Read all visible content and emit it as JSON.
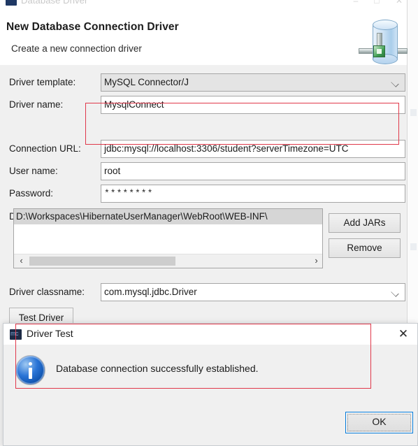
{
  "window": {
    "title": "Database Driver",
    "minimize_label": "–",
    "maximize_label": "□",
    "close_label": "✕"
  },
  "header": {
    "title": "New Database Connection Driver",
    "subtitle": "Create a new connection driver",
    "icon": "database-cylinder-icon"
  },
  "form": {
    "driver_template": {
      "label": "Driver template:",
      "value": "MySQL Connector/J",
      "caret": "chevron-down-icon"
    },
    "driver_name": {
      "label": "Driver name:",
      "value": "MysqlConnect"
    },
    "connection_url": {
      "label": "Connection URL:",
      "value": "jdbc:mysql://localhost:3306/student?serverTimezone=UTC"
    },
    "user_name": {
      "label": "User name:",
      "value": "root"
    },
    "password": {
      "label": "Password:",
      "value": "********"
    },
    "driver_jars": {
      "label": "Driver JARs",
      "items": [
        "D:\\Workspaces\\HibernateUserManager\\WebRoot\\WEB-INF\\"
      ],
      "add_button": "Add JARs",
      "remove_button": "Remove",
      "scroll_left": "‹",
      "scroll_right": "›"
    },
    "driver_classname": {
      "label": "Driver classname:",
      "value": "com.mysql.jdbc.Driver",
      "caret": "chevron-down-icon"
    },
    "test_driver_button": "Test Driver"
  },
  "dialog": {
    "title": "Driver Test",
    "icon": "mysql-app-icon",
    "close_label": "✕",
    "message": "Database connection successfully established.",
    "message_icon": "info-icon",
    "ok_button": "OK"
  },
  "annotations": {
    "accent_color": "#e0384a",
    "url_box": "connection-url-highlight",
    "dialog_box": "dialog-message-highlight"
  }
}
